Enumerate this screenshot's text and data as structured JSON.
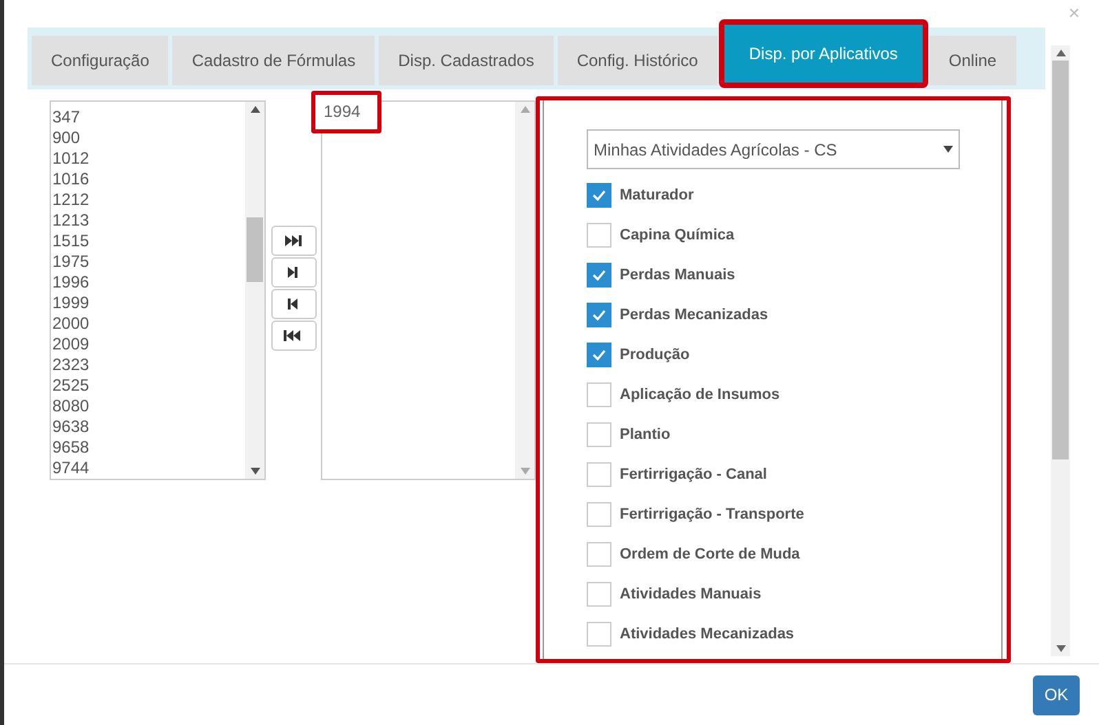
{
  "close_label": "×",
  "tabs": [
    {
      "label": "Configuração",
      "selected": false
    },
    {
      "label": "Cadastro de Fórmulas",
      "selected": false
    },
    {
      "label": "Disp. Cadastrados",
      "selected": false
    },
    {
      "label": "Config. Histórico",
      "selected": false
    },
    {
      "label": "Disp. por Aplicativos",
      "selected": true
    },
    {
      "label": "Online",
      "selected": false
    }
  ],
  "available_list": [
    "347",
    "900",
    "1012",
    "1016",
    "1212",
    "1213",
    "1515",
    "1975",
    "1996",
    "1999",
    "2000",
    "2009",
    "2323",
    "2525",
    "8080",
    "9638",
    "9658",
    "9744"
  ],
  "transfer_buttons": [
    {
      "kind": "all-right"
    },
    {
      "kind": "right"
    },
    {
      "kind": "left"
    },
    {
      "kind": "all-left"
    }
  ],
  "selected_list": [
    "1994"
  ],
  "app_select": {
    "value": "Minhas Atividades Agrícolas - CS"
  },
  "activities": [
    {
      "label": "Maturador",
      "checked": true
    },
    {
      "label": "Capina Química",
      "checked": false
    },
    {
      "label": "Perdas Manuais",
      "checked": true
    },
    {
      "label": "Perdas Mecanizadas",
      "checked": true
    },
    {
      "label": "Produção",
      "checked": true
    },
    {
      "label": "Aplicação de Insumos",
      "checked": false
    },
    {
      "label": "Plantio",
      "checked": false
    },
    {
      "label": "Fertirrigação - Canal",
      "checked": false
    },
    {
      "label": "Fertirrigação - Transporte",
      "checked": false
    },
    {
      "label": "Ordem de Corte de Muda",
      "checked": false
    },
    {
      "label": "Atividades Manuais",
      "checked": false
    },
    {
      "label": "Atividades Mecanizadas",
      "checked": false
    }
  ],
  "ok_button": "OK"
}
